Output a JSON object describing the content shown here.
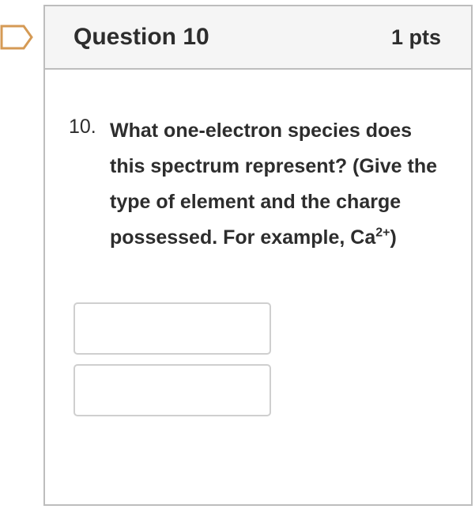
{
  "question": {
    "title": "Question 10",
    "points": "1 pts",
    "number": "10.",
    "text_main": "What one-electron species does this spectrum represent? (Give the type of element and the charge possessed. For example, Ca",
    "text_sup": "2+",
    "text_end": ")"
  },
  "answers": [
    {
      "value": ""
    },
    {
      "value": ""
    }
  ],
  "colors": {
    "flag_border": "#d59a55",
    "header_bg": "#f5f5f5",
    "border": "#bdbdbd",
    "text": "#2d2d2d"
  },
  "icons": {
    "flag": "bookmark-flag-icon"
  }
}
